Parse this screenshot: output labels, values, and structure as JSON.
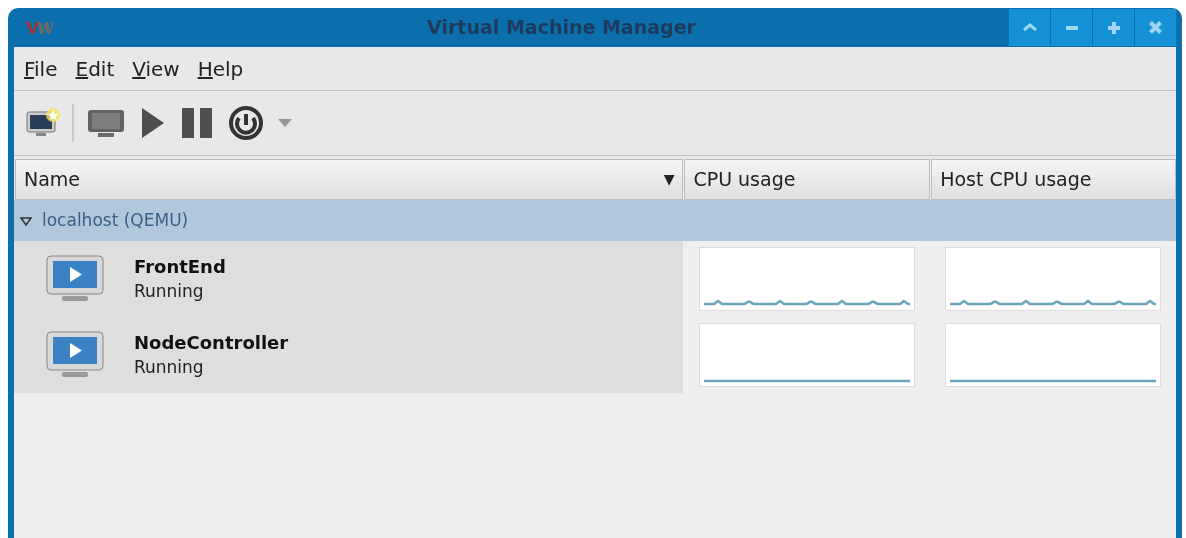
{
  "window": {
    "title": "Virtual Machine Manager",
    "buttons": [
      {
        "kind": "shade"
      },
      {
        "kind": "minimize"
      },
      {
        "kind": "maximize"
      },
      {
        "kind": "close"
      }
    ]
  },
  "menu": [
    {
      "label": "File"
    },
    {
      "label": "Edit"
    },
    {
      "label": "View"
    },
    {
      "label": "Help"
    }
  ],
  "toolbar": [
    {
      "kind": "new"
    },
    {
      "kind": "separator"
    },
    {
      "kind": "console",
      "disabled": true
    },
    {
      "kind": "run",
      "disabled": true
    },
    {
      "kind": "pause",
      "disabled": true
    },
    {
      "kind": "power",
      "disabled": false
    },
    {
      "kind": "dropdown",
      "disabled": true
    }
  ],
  "table": {
    "columns": [
      {
        "label": "Name",
        "sort": "▼"
      },
      {
        "label": "CPU usage"
      },
      {
        "label": "Host CPU usage"
      }
    ],
    "groups": [
      {
        "name": "localhost (QEMU)",
        "expanded": true,
        "rows": [
          {
            "name": "FrontEnd",
            "status": "Running",
            "cpu_graph": {
              "kind": "spiky"
            },
            "host_cpu_graph": {
              "kind": "spiky"
            }
          },
          {
            "name": "NodeController",
            "status": "Running",
            "cpu_graph": {
              "kind": "flat"
            },
            "host_cpu_graph": {
              "kind": "flat"
            }
          }
        ]
      }
    ]
  }
}
